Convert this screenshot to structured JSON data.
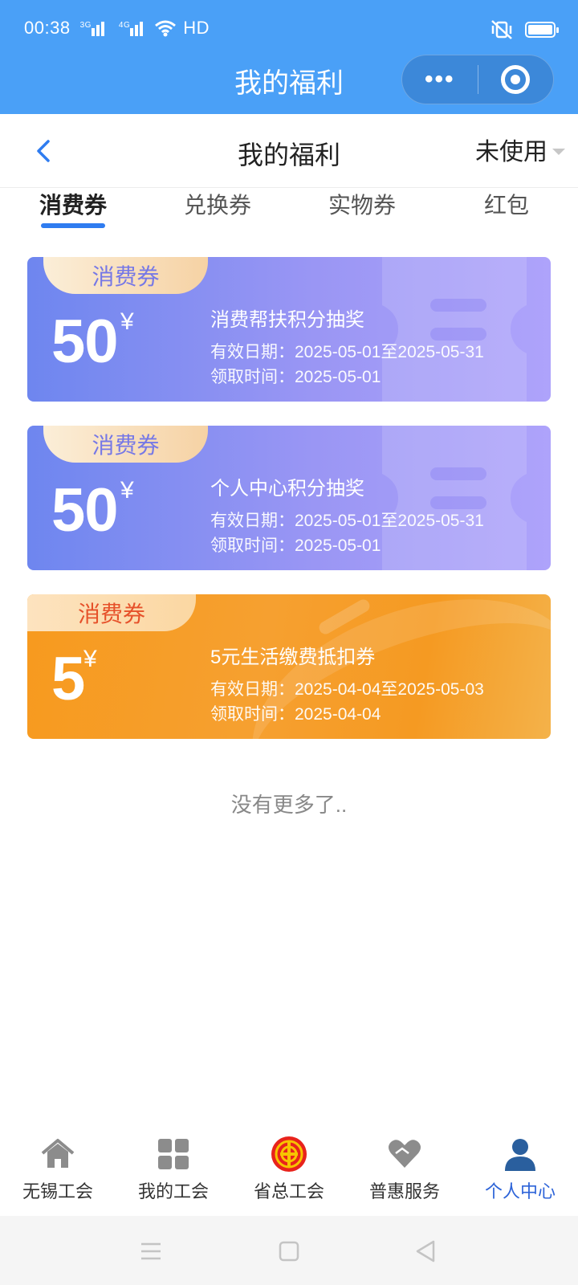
{
  "status_bar": {
    "time": "00:38",
    "sig1_tag": "3G",
    "sig2_tag": "4G",
    "hd": "HD"
  },
  "mini_program": {
    "title": "我的福利",
    "more_label": "•••"
  },
  "header": {
    "title": "我的福利",
    "filter_label": "未使用"
  },
  "tabs": [
    {
      "label": "消费券",
      "active": true
    },
    {
      "label": "兑换券",
      "active": false
    },
    {
      "label": "实物券",
      "active": false
    },
    {
      "label": "红包",
      "active": false
    }
  ],
  "coupons": [
    {
      "tag": "消费券",
      "amount": "50",
      "currency": "¥",
      "name": "消费帮扶积分抽奖",
      "valid_text": "有效日期：2025-05-01至2025-05-31",
      "received_text": "领取时间：2025-05-01",
      "style": "blue"
    },
    {
      "tag": "消费券",
      "amount": "50",
      "currency": "¥",
      "name": "个人中心积分抽奖",
      "valid_text": "有效日期：2025-05-01至2025-05-31",
      "received_text": "领取时间：2025-05-01",
      "style": "blue"
    },
    {
      "tag": "消费券",
      "amount": "5",
      "currency": "¥",
      "name": "5元生活缴费抵扣券",
      "valid_text": "有效日期：2025-04-04至2025-05-03",
      "received_text": "领取时间：2025-04-04",
      "style": "orange"
    }
  ],
  "no_more_text": "没有更多了..",
  "bottom_nav": [
    {
      "label": "无锡工会",
      "icon": "home-icon",
      "active": false
    },
    {
      "label": "我的工会",
      "icon": "grid-icon",
      "active": false
    },
    {
      "label": "省总工会",
      "icon": "union-emblem-icon",
      "active": false
    },
    {
      "label": "普惠服务",
      "icon": "heart-hands-icon",
      "active": false
    },
    {
      "label": "个人中心",
      "icon": "person-icon",
      "active": true
    }
  ],
  "colors": {
    "topbar": "#4aa0f7",
    "accent": "#2f7cf0",
    "active_nav": "#2c63d8",
    "coupon_blue_start": "#6e86ef",
    "coupon_blue_end": "#aea3fb",
    "coupon_orange": "#f79a1e"
  }
}
